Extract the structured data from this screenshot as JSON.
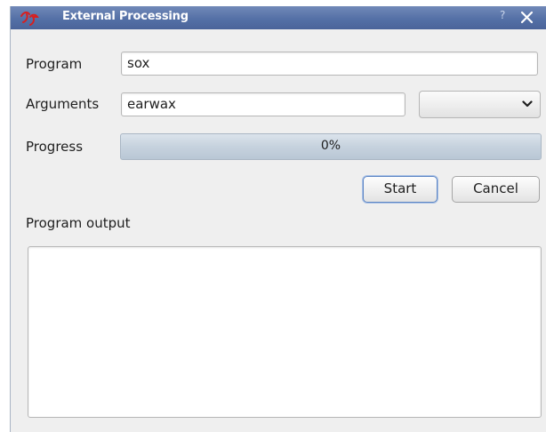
{
  "window": {
    "title": "External Processing",
    "help_glyph": "?",
    "icons": {
      "app": "app-logo-icon",
      "close": "close-icon"
    },
    "colors": {
      "titlebar": "#5470a6",
      "close": "#ffffff"
    }
  },
  "form": {
    "program_label": "Program",
    "program_value": "sox",
    "arguments_label": "Arguments",
    "arguments_value": "earwax",
    "arguments_combo_value": "",
    "progress_label": "Progress",
    "progress_text": "0%",
    "progress_value": 0
  },
  "buttons": {
    "start_label": "Start",
    "cancel_label": "Cancel"
  },
  "output": {
    "label": "Program output",
    "text": ""
  }
}
